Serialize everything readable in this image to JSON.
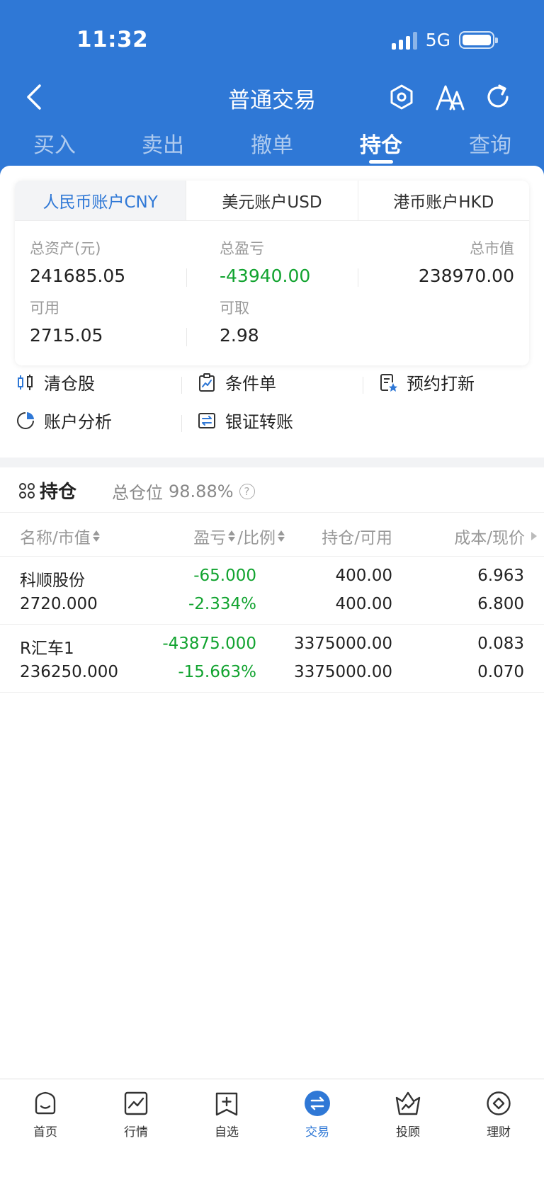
{
  "status_bar": {
    "time": "11:32",
    "network": "5G"
  },
  "header": {
    "title": "普通交易",
    "icons": [
      "back-icon",
      "settings-hex-icon",
      "font-size-icon",
      "refresh-icon"
    ]
  },
  "tabs": [
    {
      "label": "买入"
    },
    {
      "label": "卖出"
    },
    {
      "label": "撤单"
    },
    {
      "label": "持仓",
      "active": true
    },
    {
      "label": "查询"
    }
  ],
  "account_tabs": [
    {
      "label": "人民币账户CNY",
      "active": true
    },
    {
      "label": "美元账户USD"
    },
    {
      "label": "港币账户HKD"
    }
  ],
  "summary": {
    "total_assets_label": "总资产(元)",
    "total_assets": "241685.05",
    "total_pnl_label": "总盈亏",
    "total_pnl": "-43940.00",
    "market_value_label": "总市值",
    "market_value": "238970.00",
    "available_label": "可用",
    "available": "2715.05",
    "withdrawable_label": "可取",
    "withdrawable": "2.98"
  },
  "tools": [
    {
      "label": "清仓股",
      "icon": "candlestick-icon"
    },
    {
      "label": "条件单",
      "icon": "clipboard-chart-icon"
    },
    {
      "label": "预约打新",
      "icon": "subscription-star-icon"
    },
    {
      "label": "账户分析",
      "icon": "pie-chart-icon"
    },
    {
      "label": "银证转账",
      "icon": "transfer-icon"
    }
  ],
  "positions": {
    "title": "持仓",
    "ratio_label": "总仓位",
    "ratio_value": "98.88%",
    "columns": [
      "名称/市值",
      "盈亏",
      "/比例",
      "持仓/可用",
      "成本/现价"
    ],
    "rows": [
      {
        "name": "科顺股份",
        "market_value": "2720.000",
        "pnl": "-65.000",
        "pnl_pct": "-2.334%",
        "holding": "400.00",
        "available": "400.00",
        "cost": "6.963",
        "price": "6.800"
      },
      {
        "name": "R汇车1",
        "market_value": "236250.000",
        "pnl": "-43875.000",
        "pnl_pct": "-15.663%",
        "holding": "3375000.00",
        "available": "3375000.00",
        "cost": "0.083",
        "price": "0.070"
      }
    ]
  },
  "bottom_nav": [
    {
      "label": "首页",
      "icon": "home-icon"
    },
    {
      "label": "行情",
      "icon": "market-chart-icon"
    },
    {
      "label": "自选",
      "icon": "watchlist-add-icon"
    },
    {
      "label": "交易",
      "icon": "trade-exchange-icon",
      "active": true
    },
    {
      "label": "投顾",
      "icon": "advisor-crown-icon"
    },
    {
      "label": "理财",
      "icon": "wealth-icon"
    }
  ],
  "colors": {
    "primary": "#2f78d6",
    "loss_green": "#11a32f"
  }
}
